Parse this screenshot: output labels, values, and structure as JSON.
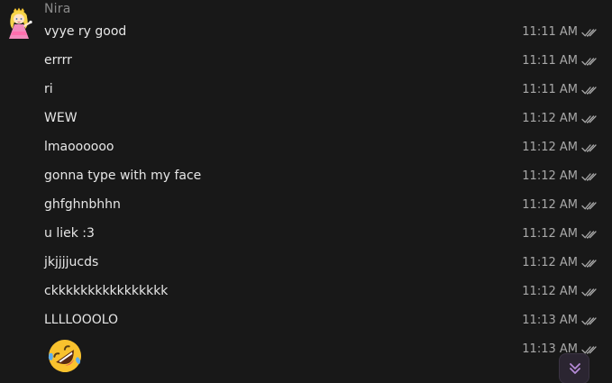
{
  "sender": {
    "name": "Nira"
  },
  "messages": [
    {
      "text": "vyye ry good",
      "time": "11:11 AM"
    },
    {
      "text": "errrr",
      "time": "11:11 AM"
    },
    {
      "text": "ri",
      "time": "11:11 AM"
    },
    {
      "text": "WEW",
      "time": "11:12 AM"
    },
    {
      "text": "lmaoooooo",
      "time": "11:12 AM"
    },
    {
      "text": "gonna type with my face",
      "time": "11:12 AM"
    },
    {
      "text": "ghfghnbhhn",
      "time": "11:12 AM"
    },
    {
      "text": "u liek :3",
      "time": "11:12 AM"
    },
    {
      "text": "jkjjjjucds",
      "time": "11:12 AM"
    },
    {
      "text": "ckkkkkkkkkkkkkkkk",
      "time": "11:12 AM"
    },
    {
      "text": "LLLLOOOLO",
      "time": "11:13 AM"
    }
  ],
  "emoji_message": {
    "emoji_name": "rolling-on-floor-laughing-icon",
    "time": "11:13 AM"
  },
  "icons": {
    "read_receipt": "double-check-icon",
    "scroll": "double-chevron-down-icon"
  },
  "colors": {
    "background": "#181818",
    "text": "#e6e6e6",
    "meta": "#a8a8a8",
    "accent": "#b58ad6"
  }
}
